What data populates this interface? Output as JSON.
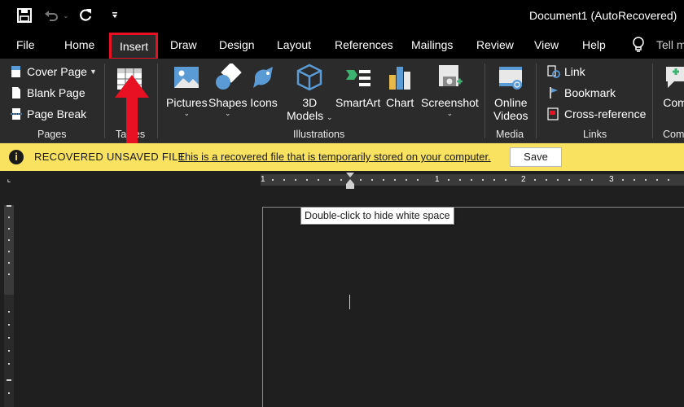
{
  "window": {
    "title": "Document1 (AutoRecovered)"
  },
  "tabs": [
    "File",
    "Home",
    "Insert",
    "Draw",
    "Design",
    "Layout",
    "References",
    "Mailings",
    "Review",
    "View",
    "Help"
  ],
  "tell_me": "Tell m",
  "ribbon": {
    "pages": {
      "cover_page": "Cover Page",
      "blank_page": "Blank Page",
      "page_break": "Page Break",
      "label": "Pages"
    },
    "tables": {
      "label": "Tables"
    },
    "illustrations": {
      "pictures": "Pictures",
      "shapes": "Shapes",
      "icons": "Icons",
      "models_3d_top": "3D",
      "models_3d_bottom": "Models",
      "smartart": "SmartArt",
      "chart": "Chart",
      "screenshot": "Screenshot",
      "label": "Illustrations"
    },
    "media": {
      "online_videos_top": "Online",
      "online_videos_bottom": "Videos",
      "label": "Media"
    },
    "links": {
      "link": "Link",
      "bookmark": "Bookmark",
      "cross_reference": "Cross-reference",
      "label": "Links"
    },
    "comments": {
      "comment": "Com",
      "label": "Com"
    }
  },
  "infobar": {
    "title": "RECOVERED UNSAVED FILE",
    "message": "This is a recovered file that is temporarily stored on your computer.",
    "save_label": "Save"
  },
  "ruler": {
    "numbers": [
      "1",
      "1",
      "2",
      "3"
    ]
  },
  "tooltip": "Double-click to hide white space",
  "colors": {
    "accent_red": "#e81123",
    "infobar_yellow": "#f9e25f",
    "ribbon_bg": "#2b2b2b"
  },
  "icons": {
    "save": "save-icon",
    "undo": "undo-icon",
    "redo": "redo-icon",
    "customize": "customize-qat-icon",
    "lightbulb": "lightbulb-icon"
  }
}
